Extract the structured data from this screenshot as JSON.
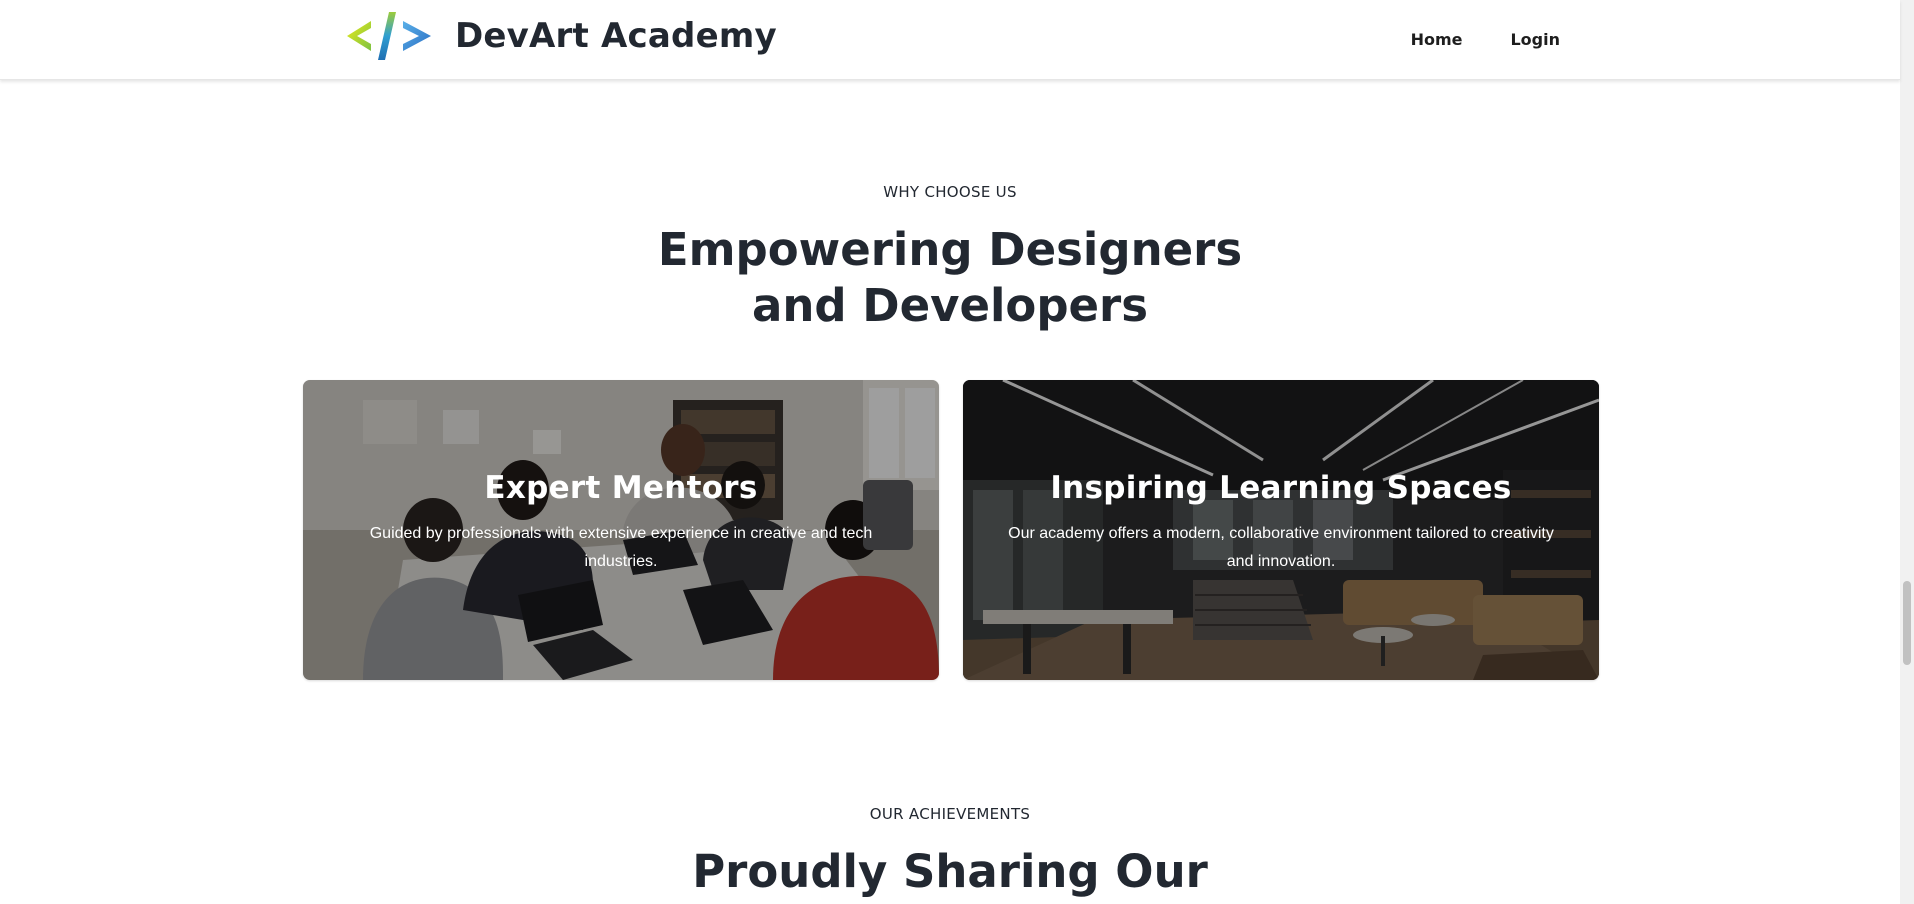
{
  "header": {
    "brand": "DevArt Academy",
    "logo_icon": "code-brackets-icon",
    "nav": [
      {
        "label": "Home"
      },
      {
        "label": "Login"
      }
    ]
  },
  "why_choose_us": {
    "eyebrow": "WHY CHOOSE US",
    "title_line1": "Empowering Designers",
    "title_line2": "and Developers",
    "cards": [
      {
        "title": "Expert Mentors",
        "description": "Guided by professionals with extensive experience in creative and tech industries."
      },
      {
        "title": "Inspiring Learning Spaces",
        "description": "Our academy offers a modern, collaborative environment tailored to creativity and innovation."
      }
    ]
  },
  "achievements": {
    "eyebrow": "OUR ACHIEVEMENTS",
    "title_line1": "Proudly Sharing Our"
  },
  "colors": {
    "text_dark": "#222831",
    "logo_green": "#8dc63f",
    "logo_yellow": "#e6e600",
    "logo_blue": "#3a8fe0"
  }
}
